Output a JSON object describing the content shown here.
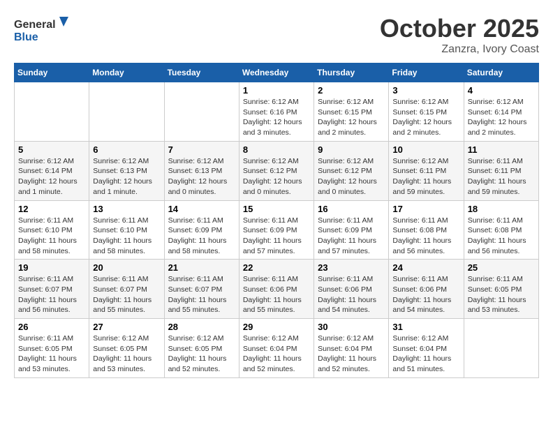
{
  "header": {
    "logo_general": "General",
    "logo_blue": "Blue",
    "month": "October 2025",
    "location": "Zanzra, Ivory Coast"
  },
  "days_of_week": [
    "Sunday",
    "Monday",
    "Tuesday",
    "Wednesday",
    "Thursday",
    "Friday",
    "Saturday"
  ],
  "weeks": [
    [
      {
        "day": "",
        "info": ""
      },
      {
        "day": "",
        "info": ""
      },
      {
        "day": "",
        "info": ""
      },
      {
        "day": "1",
        "info": "Sunrise: 6:12 AM\nSunset: 6:16 PM\nDaylight: 12 hours and 3 minutes."
      },
      {
        "day": "2",
        "info": "Sunrise: 6:12 AM\nSunset: 6:15 PM\nDaylight: 12 hours and 2 minutes."
      },
      {
        "day": "3",
        "info": "Sunrise: 6:12 AM\nSunset: 6:15 PM\nDaylight: 12 hours and 2 minutes."
      },
      {
        "day": "4",
        "info": "Sunrise: 6:12 AM\nSunset: 6:14 PM\nDaylight: 12 hours and 2 minutes."
      }
    ],
    [
      {
        "day": "5",
        "info": "Sunrise: 6:12 AM\nSunset: 6:14 PM\nDaylight: 12 hours and 1 minute."
      },
      {
        "day": "6",
        "info": "Sunrise: 6:12 AM\nSunset: 6:13 PM\nDaylight: 12 hours and 1 minute."
      },
      {
        "day": "7",
        "info": "Sunrise: 6:12 AM\nSunset: 6:13 PM\nDaylight: 12 hours and 0 minutes."
      },
      {
        "day": "8",
        "info": "Sunrise: 6:12 AM\nSunset: 6:12 PM\nDaylight: 12 hours and 0 minutes."
      },
      {
        "day": "9",
        "info": "Sunrise: 6:12 AM\nSunset: 6:12 PM\nDaylight: 12 hours and 0 minutes."
      },
      {
        "day": "10",
        "info": "Sunrise: 6:12 AM\nSunset: 6:11 PM\nDaylight: 11 hours and 59 minutes."
      },
      {
        "day": "11",
        "info": "Sunrise: 6:11 AM\nSunset: 6:11 PM\nDaylight: 11 hours and 59 minutes."
      }
    ],
    [
      {
        "day": "12",
        "info": "Sunrise: 6:11 AM\nSunset: 6:10 PM\nDaylight: 11 hours and 58 minutes."
      },
      {
        "day": "13",
        "info": "Sunrise: 6:11 AM\nSunset: 6:10 PM\nDaylight: 11 hours and 58 minutes."
      },
      {
        "day": "14",
        "info": "Sunrise: 6:11 AM\nSunset: 6:09 PM\nDaylight: 11 hours and 58 minutes."
      },
      {
        "day": "15",
        "info": "Sunrise: 6:11 AM\nSunset: 6:09 PM\nDaylight: 11 hours and 57 minutes."
      },
      {
        "day": "16",
        "info": "Sunrise: 6:11 AM\nSunset: 6:09 PM\nDaylight: 11 hours and 57 minutes."
      },
      {
        "day": "17",
        "info": "Sunrise: 6:11 AM\nSunset: 6:08 PM\nDaylight: 11 hours and 56 minutes."
      },
      {
        "day": "18",
        "info": "Sunrise: 6:11 AM\nSunset: 6:08 PM\nDaylight: 11 hours and 56 minutes."
      }
    ],
    [
      {
        "day": "19",
        "info": "Sunrise: 6:11 AM\nSunset: 6:07 PM\nDaylight: 11 hours and 56 minutes."
      },
      {
        "day": "20",
        "info": "Sunrise: 6:11 AM\nSunset: 6:07 PM\nDaylight: 11 hours and 55 minutes."
      },
      {
        "day": "21",
        "info": "Sunrise: 6:11 AM\nSunset: 6:07 PM\nDaylight: 11 hours and 55 minutes."
      },
      {
        "day": "22",
        "info": "Sunrise: 6:11 AM\nSunset: 6:06 PM\nDaylight: 11 hours and 55 minutes."
      },
      {
        "day": "23",
        "info": "Sunrise: 6:11 AM\nSunset: 6:06 PM\nDaylight: 11 hours and 54 minutes."
      },
      {
        "day": "24",
        "info": "Sunrise: 6:11 AM\nSunset: 6:06 PM\nDaylight: 11 hours and 54 minutes."
      },
      {
        "day": "25",
        "info": "Sunrise: 6:11 AM\nSunset: 6:05 PM\nDaylight: 11 hours and 53 minutes."
      }
    ],
    [
      {
        "day": "26",
        "info": "Sunrise: 6:11 AM\nSunset: 6:05 PM\nDaylight: 11 hours and 53 minutes."
      },
      {
        "day": "27",
        "info": "Sunrise: 6:12 AM\nSunset: 6:05 PM\nDaylight: 11 hours and 53 minutes."
      },
      {
        "day": "28",
        "info": "Sunrise: 6:12 AM\nSunset: 6:05 PM\nDaylight: 11 hours and 52 minutes."
      },
      {
        "day": "29",
        "info": "Sunrise: 6:12 AM\nSunset: 6:04 PM\nDaylight: 11 hours and 52 minutes."
      },
      {
        "day": "30",
        "info": "Sunrise: 6:12 AM\nSunset: 6:04 PM\nDaylight: 11 hours and 52 minutes."
      },
      {
        "day": "31",
        "info": "Sunrise: 6:12 AM\nSunset: 6:04 PM\nDaylight: 11 hours and 51 minutes."
      },
      {
        "day": "",
        "info": ""
      }
    ]
  ]
}
